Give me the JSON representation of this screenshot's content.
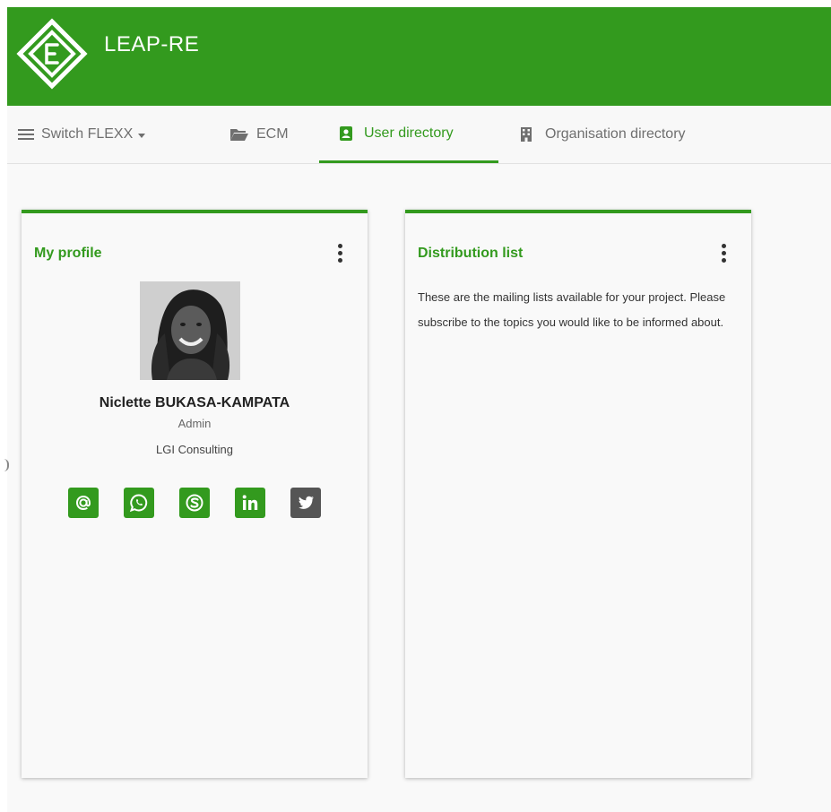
{
  "app": {
    "title": "LEAP-RE",
    "brand_color": "#339a1e"
  },
  "nav": {
    "items": [
      {
        "label": "Switch FLEXX",
        "icon": "hamburger-menu-icon",
        "has_dropdown": true
      },
      {
        "label": "ECM",
        "icon": "folder-open-icon"
      },
      {
        "label": "User directory",
        "icon": "address-book-icon",
        "active": true
      },
      {
        "label": "Organisation directory",
        "icon": "building-icon"
      }
    ]
  },
  "profile_card": {
    "title": "My profile",
    "menu_icon": "more-vertical-icon",
    "name": "Niclette BUKASA-KAMPATA",
    "role": "Admin",
    "organisation": "LGI Consulting",
    "socials": [
      {
        "icon": "email-icon",
        "color": "#339a1e"
      },
      {
        "icon": "whatsapp-icon",
        "color": "#339a1e"
      },
      {
        "icon": "skype-icon",
        "color": "#339a1e"
      },
      {
        "icon": "linkedin-icon",
        "color": "#339a1e"
      },
      {
        "icon": "twitter-icon",
        "color": "#555555"
      }
    ]
  },
  "distribution_card": {
    "title": "Distribution list",
    "menu_icon": "more-vertical-icon",
    "description": "These are the mailing lists available for your project. Please subscribe to the topics you would like to be informed about."
  }
}
